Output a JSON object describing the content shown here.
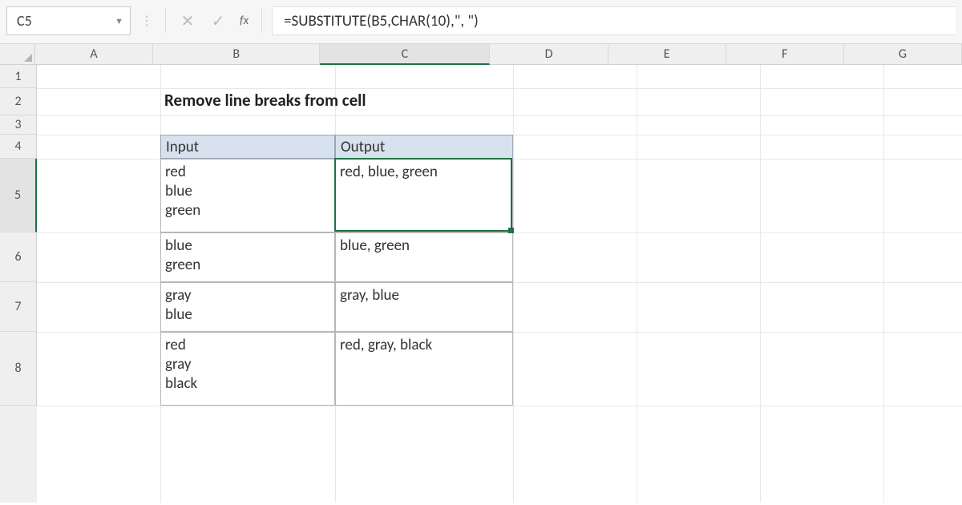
{
  "app": {
    "name_box": "C5",
    "formula": "=SUBSTITUTE(B5,CHAR(10),\", \")"
  },
  "columns": {
    "labels": [
      "A",
      "B",
      "C",
      "D",
      "E",
      "F",
      "G"
    ],
    "widths": [
      154,
      218,
      222,
      154,
      154,
      154,
      154
    ],
    "active": "C"
  },
  "rows": {
    "labels": [
      "1",
      "2",
      "3",
      "4",
      "5",
      "6",
      "7",
      "8"
    ],
    "heights": [
      29,
      34,
      24,
      30,
      92,
      62,
      62,
      92
    ],
    "active": "5"
  },
  "content": {
    "title": "Remove line breaks from cell",
    "headers": {
      "input": "Input",
      "output": "Output"
    },
    "data": [
      {
        "input": "red\nblue\ngreen",
        "output": "red, blue, green"
      },
      {
        "input": "blue\ngreen",
        "output": "blue, green"
      },
      {
        "input": "gray\nblue",
        "output": "gray, blue"
      },
      {
        "input": "red\ngray\nblack",
        "output": "red, gray, black"
      }
    ]
  },
  "selection": {
    "cell": "C5"
  }
}
